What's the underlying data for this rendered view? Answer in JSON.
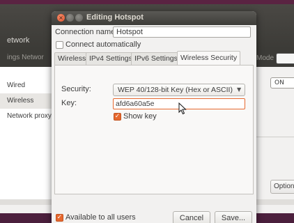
{
  "background_window": {
    "title": "etwork",
    "breadcrumb": "ings  Networ",
    "mode_label": "Mode",
    "sidebar_items": [
      "Wired",
      "Wireless",
      "Network proxy"
    ],
    "on_switch_label": "ON",
    "options_button": "Option"
  },
  "dialog": {
    "title": "Editing Hotspot",
    "connection_name_label": "Connection name:",
    "connection_name_value": "Hotspot",
    "connect_automatically_label": "Connect automatically",
    "connect_automatically_checked": false,
    "tabs": [
      {
        "label": "Wireless"
      },
      {
        "label": "IPv4 Settings"
      },
      {
        "label": "IPv6 Settings"
      },
      {
        "label": "Wireless Security"
      }
    ],
    "active_tab": "Wireless Security",
    "security_label": "Security:",
    "security_value": "WEP 40/128-bit Key (Hex or ASCII)",
    "key_label": "Key:",
    "key_value": "afd6a60a5e",
    "show_key_label": "Show key",
    "show_key_checked": true,
    "available_to_all_label": "Available to all users",
    "available_to_all_checked": true,
    "cancel_button": "Cancel",
    "save_button": "Save..."
  },
  "colors": {
    "accent": "#e6682e",
    "titlebar": "#3c3b37",
    "desktop": "#6e2c52"
  }
}
